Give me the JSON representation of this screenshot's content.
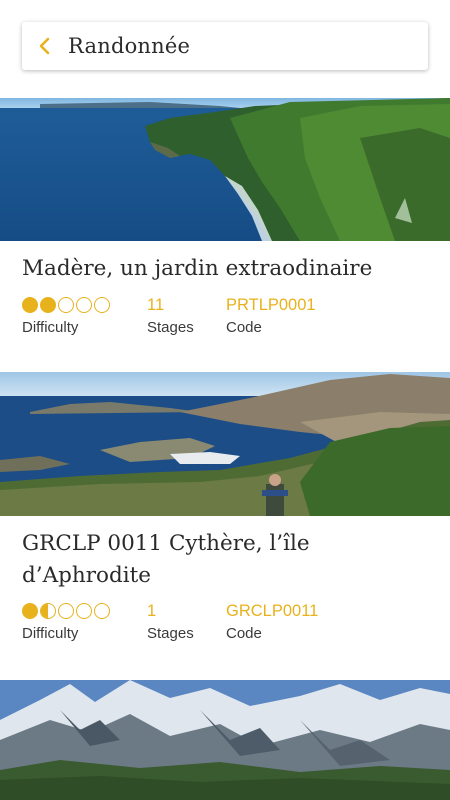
{
  "header": {
    "title": "Randonnée",
    "back_icon": "chevron-left-icon",
    "accent": "#e8b21d"
  },
  "labels": {
    "difficulty": "Difficulty",
    "stages": "Stages",
    "code": "Code"
  },
  "treks": [
    {
      "title": "Madère, un jardin extraodinaire",
      "difficulty": 2,
      "stages": "11",
      "code": "PRTLP0001",
      "image": "coastal cliffs and sea"
    },
    {
      "title": "GRCLP 0011 Cythère, l’île d’Aphrodite",
      "difficulty": 1.5,
      "stages": "1",
      "code": "GRCLP0011",
      "image": "island bay with hiker"
    },
    {
      "title": "",
      "difficulty": null,
      "stages": "",
      "code": "",
      "image": "snowy mountain range"
    }
  ]
}
